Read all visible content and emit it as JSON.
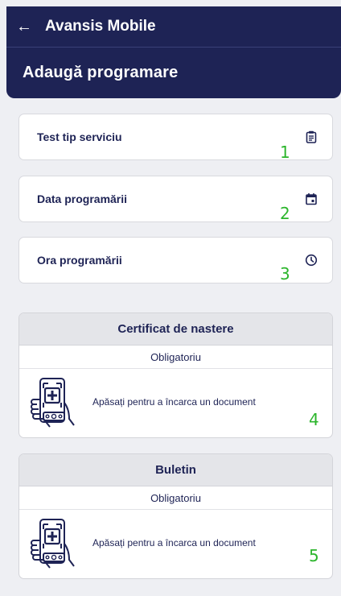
{
  "appbar": {
    "back_icon": "arrow-left-icon",
    "title": "Avansis Mobile"
  },
  "header": {
    "title": "Adaugă programare"
  },
  "fields": [
    {
      "label": "Test tip serviciu",
      "icon": "clipboard-icon",
      "number": "1"
    },
    {
      "label": "Data programării",
      "icon": "calendar-icon",
      "number": "2"
    },
    {
      "label": "Ora programării",
      "icon": "clock-icon",
      "number": "3"
    }
  ],
  "documents": [
    {
      "title": "Certificat de nastere",
      "requirement": "Obligatoriu",
      "upload_text": "Apăsați pentru a încarca un document",
      "icon": "phone-upload-icon",
      "number": "4"
    },
    {
      "title": "Buletin",
      "requirement": "Obligatoriu",
      "upload_text": "Apăsați pentru a încarca un document",
      "icon": "phone-upload-icon",
      "number": "5"
    }
  ],
  "colors": {
    "primary": "#1e2355",
    "background": "#eeeff3",
    "annotation": "#2cb52c"
  }
}
